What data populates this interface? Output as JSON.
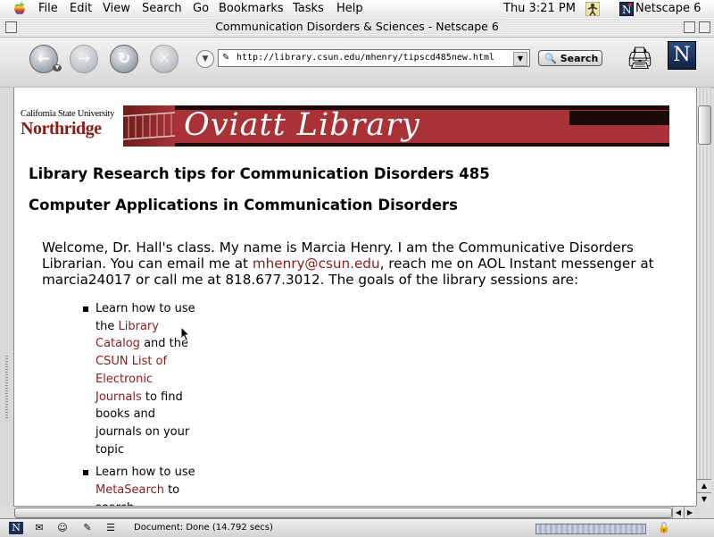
{
  "menubar": {
    "items": [
      "File",
      "Edit",
      "View",
      "Search",
      "Go",
      "Bookmarks",
      "Tasks",
      "Help"
    ],
    "clock": "Thu 3:21 PM",
    "app_name": "Netscape 6"
  },
  "window": {
    "title": "Communication Disorders & Sciences - Netscape 6"
  },
  "toolbar": {
    "url": "http://library.csun.edu/mhenry/tipscd485new.html",
    "search_label": "Search",
    "netscape_logo": "N"
  },
  "banner": {
    "university_line1": "California State University",
    "university_line2": "Northridge",
    "library_name": "Oviatt Library"
  },
  "page": {
    "heading1": "Library Research tips for Communication Disorders 485",
    "heading2": "Computer Applications in Communication Disorders",
    "welcome_part1": "Welcome, Dr. Hall's class. My name is Marcia Henry. I am the Communicative Disorders Librarian. You can email me at ",
    "email_link": "mhenry@csun.edu",
    "welcome_part2": ", reach me on AOL Instant messenger at marcia24017 or call me at 818.677.3012. The goals of the library sessions are:",
    "goal1_part1": "Learn how to use the ",
    "goal1_link1": "Library Catalog",
    "goal1_part2": " and the ",
    "goal1_link2": "CSUN List of Electronic Journals",
    "goal1_part3": " to find books and journals on your topic",
    "goal2_part1": "Learn how to use ",
    "goal2_link1": "MetaSearch",
    "goal2_part2": " to search"
  },
  "status": {
    "text": "Document: Done (14.792 secs)"
  },
  "colors": {
    "link": "#8b1a1a",
    "banner_red": "#a83236"
  }
}
